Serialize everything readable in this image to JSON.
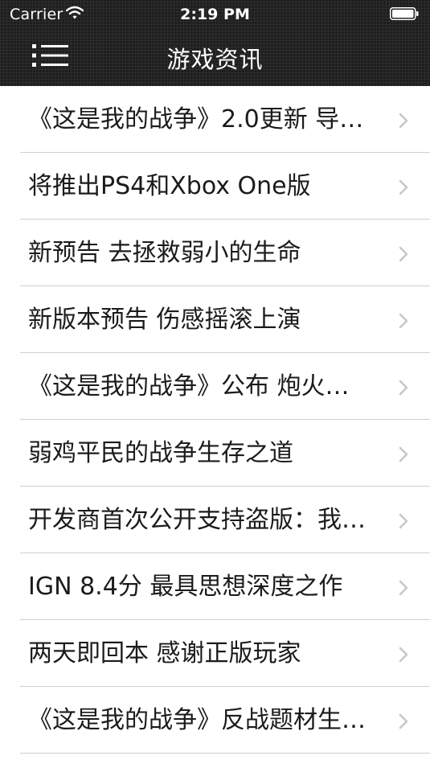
{
  "status_bar": {
    "carrier": "Carrier",
    "time": "2:19 PM",
    "wifi_icon": "wifi-icon",
    "battery_icon": "battery-icon"
  },
  "nav": {
    "title": "游戏资讯",
    "menu_icon": "menu-list-icon"
  },
  "news": {
    "items": [
      {
        "title": "《这是我的战争》2.0更新 导…"
      },
      {
        "title": "将推出PS4和Xbox One版"
      },
      {
        "title": "新预告 去拯救弱小的生命"
      },
      {
        "title": "新版本预告 伤感摇滚上演"
      },
      {
        "title": "《这是我的战争》公布 炮火…"
      },
      {
        "title": "弱鸡平民的战争生存之道"
      },
      {
        "title": "开发商首次公开支持盗版：我…"
      },
      {
        "title": "IGN 8.4分 最具思想深度之作"
      },
      {
        "title": "两天即回本 感谢正版玩家"
      },
      {
        "title": "《这是我的战争》反战题材生…"
      }
    ],
    "chevron_icon": "chevron-right-icon"
  },
  "colors": {
    "nav_background": "#1f1f1f",
    "separator": "#cfcfd4",
    "chevron": "#c7c7cc",
    "text": "#1b1b1b"
  }
}
